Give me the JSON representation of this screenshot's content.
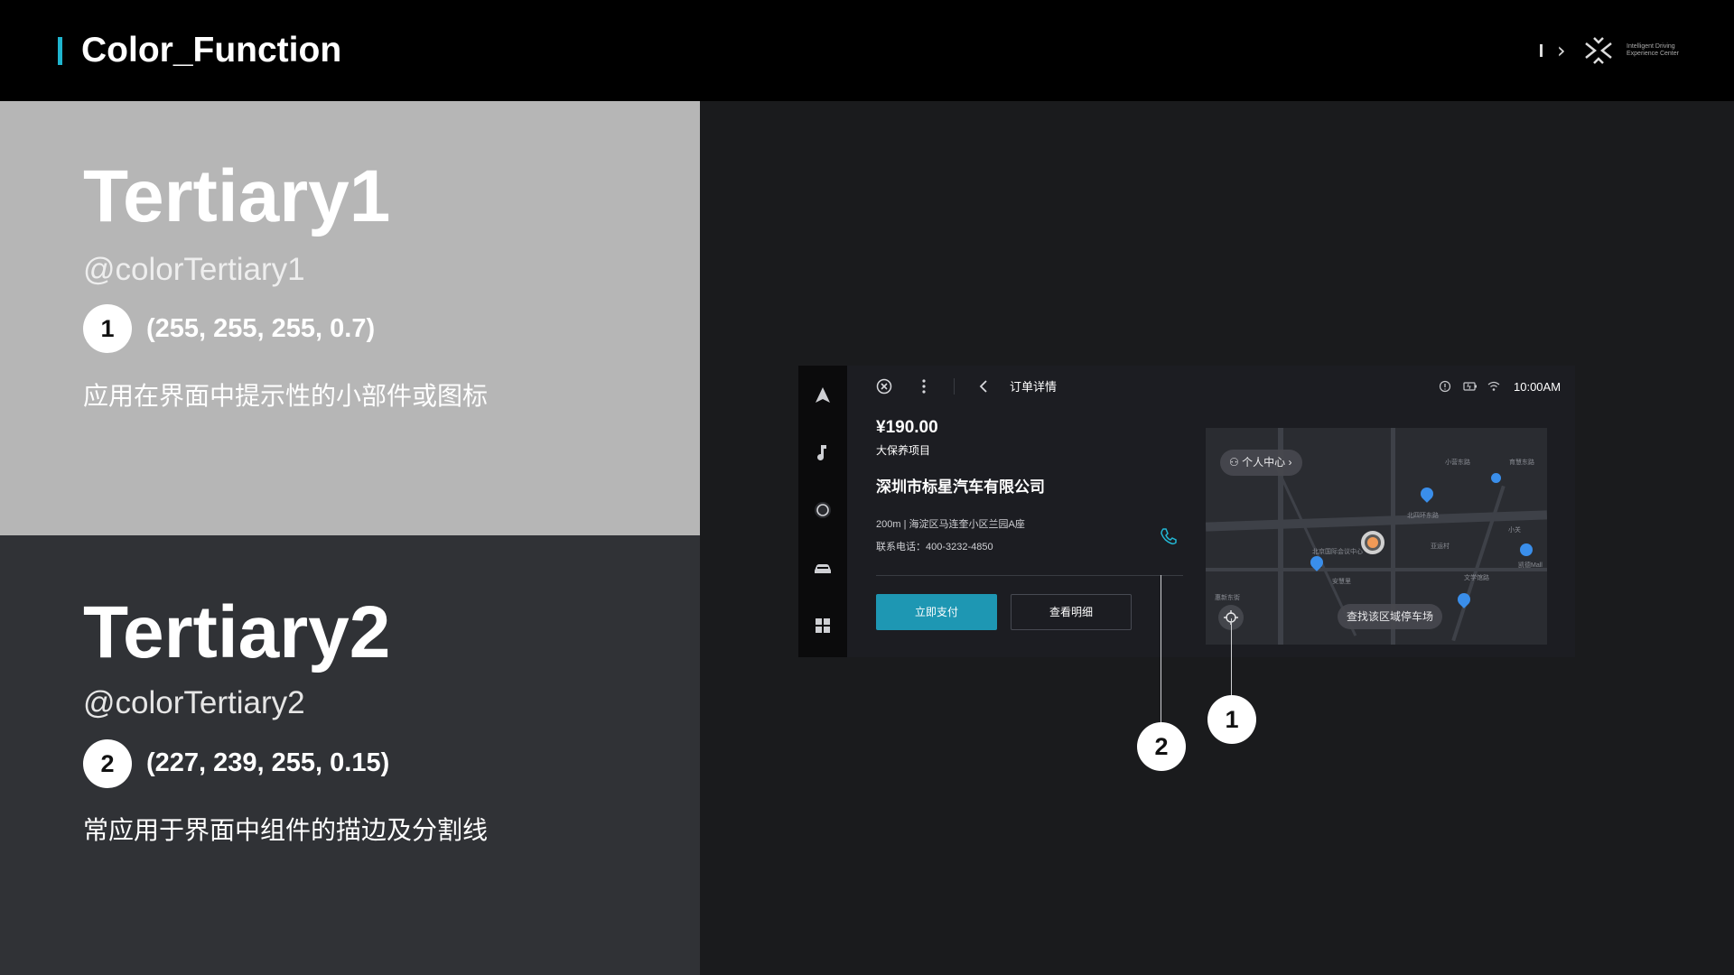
{
  "header": {
    "title": "Color_Function",
    "brand_text_line1": "Intelligent Driving",
    "brand_text_line2": "Experience Center"
  },
  "tertiary1": {
    "title": "Tertiary1",
    "token": "@colorTertiary1",
    "badge": "1",
    "rgba": "(255, 255, 255, 0.7)",
    "desc": "应用在界面中提示性的小部件或图标"
  },
  "tertiary2": {
    "title": "Tertiary2",
    "token": "@colorTertiary2",
    "badge": "2",
    "rgba": "(227, 239, 255, 0.15)",
    "desc": "常应用于界面中组件的描边及分割线"
  },
  "device": {
    "page_title": "订单详情",
    "time": "10:00AM",
    "price": "¥190.00",
    "service": "大保养项目",
    "company": "深圳市标星汽车有限公司",
    "address": "200m | 海淀区马连奎小区兰园A座",
    "phone": "联系电话：400-3232-4850",
    "pay_button": "立即支付",
    "detail_button": "查看明细",
    "map_chip_personal": "个人中心",
    "map_chip_parking": "查找该区域停车场",
    "map_labels": [
      "北京国际会议中心",
      "北四环东路",
      "小营东路",
      "育慧东路",
      "亚运村",
      "文学馆路",
      "小关",
      "凯德Mall",
      "安慧里",
      "惠新东街"
    ]
  },
  "callouts": [
    "1",
    "2"
  ],
  "colors": {
    "accent": "#1fb5cf",
    "button": "#1e97b3",
    "panel_light": "#b6b6b6",
    "panel_dark": "#303236",
    "pin": "#3a8eea",
    "user_marker": "#f09a57"
  }
}
